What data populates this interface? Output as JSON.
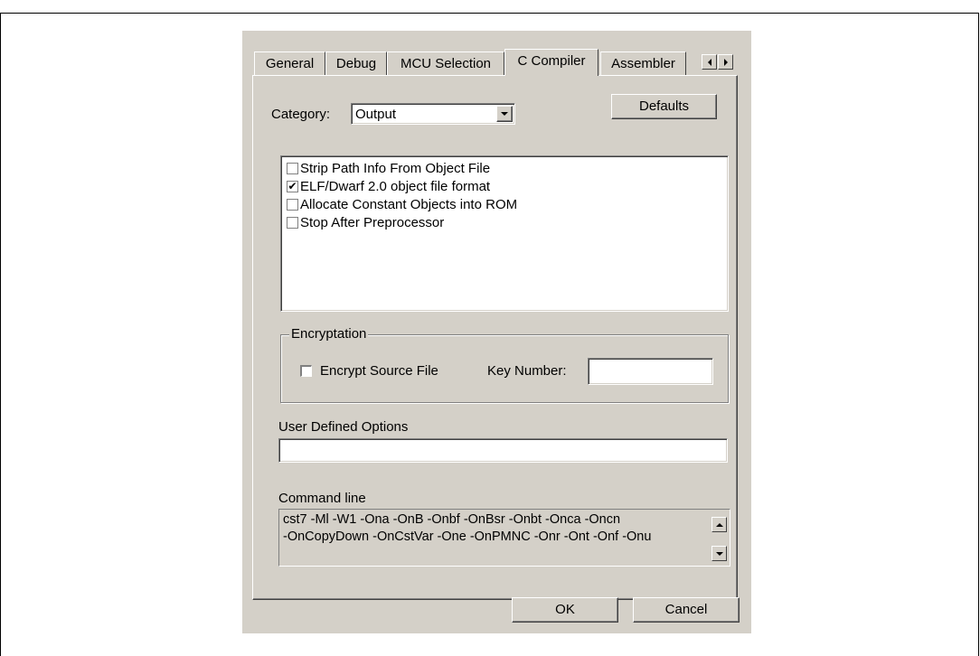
{
  "dialog": {
    "tabs": [
      {
        "label": "General"
      },
      {
        "label": "Debug"
      },
      {
        "label": "MCU Selection"
      },
      {
        "label": "C Compiler"
      },
      {
        "label": "Assembler"
      }
    ],
    "active_tab": "C Compiler",
    "category": {
      "label": "Category:",
      "value": "Output"
    },
    "defaults_button": "Defaults",
    "options": [
      {
        "label": "Strip Path Info From Object File",
        "checked": false
      },
      {
        "label": "ELF/Dwarf 2.0 object file format",
        "checked": true
      },
      {
        "label": "Allocate Constant Objects into ROM",
        "checked": false
      },
      {
        "label": "Stop After Preprocessor",
        "checked": false
      }
    ],
    "encryption": {
      "group_label": "Encryptation",
      "encrypt_label": "Encrypt Source File",
      "encrypt_checked": false,
      "key_label": "Key Number:",
      "key_value": ""
    },
    "user_options": {
      "label": "User Defined Options",
      "value": ""
    },
    "command_line": {
      "label": "Command line",
      "line1": "cst7  -Ml -W1 -Ona -OnB -Onbf -OnBsr -Onbt -Onca -Oncn",
      "line2": "-OnCopyDown -OnCstVar -One -OnPMNC -Onr -Ont -Onf -Onu"
    },
    "ok_button": "OK",
    "cancel_button": "Cancel"
  }
}
